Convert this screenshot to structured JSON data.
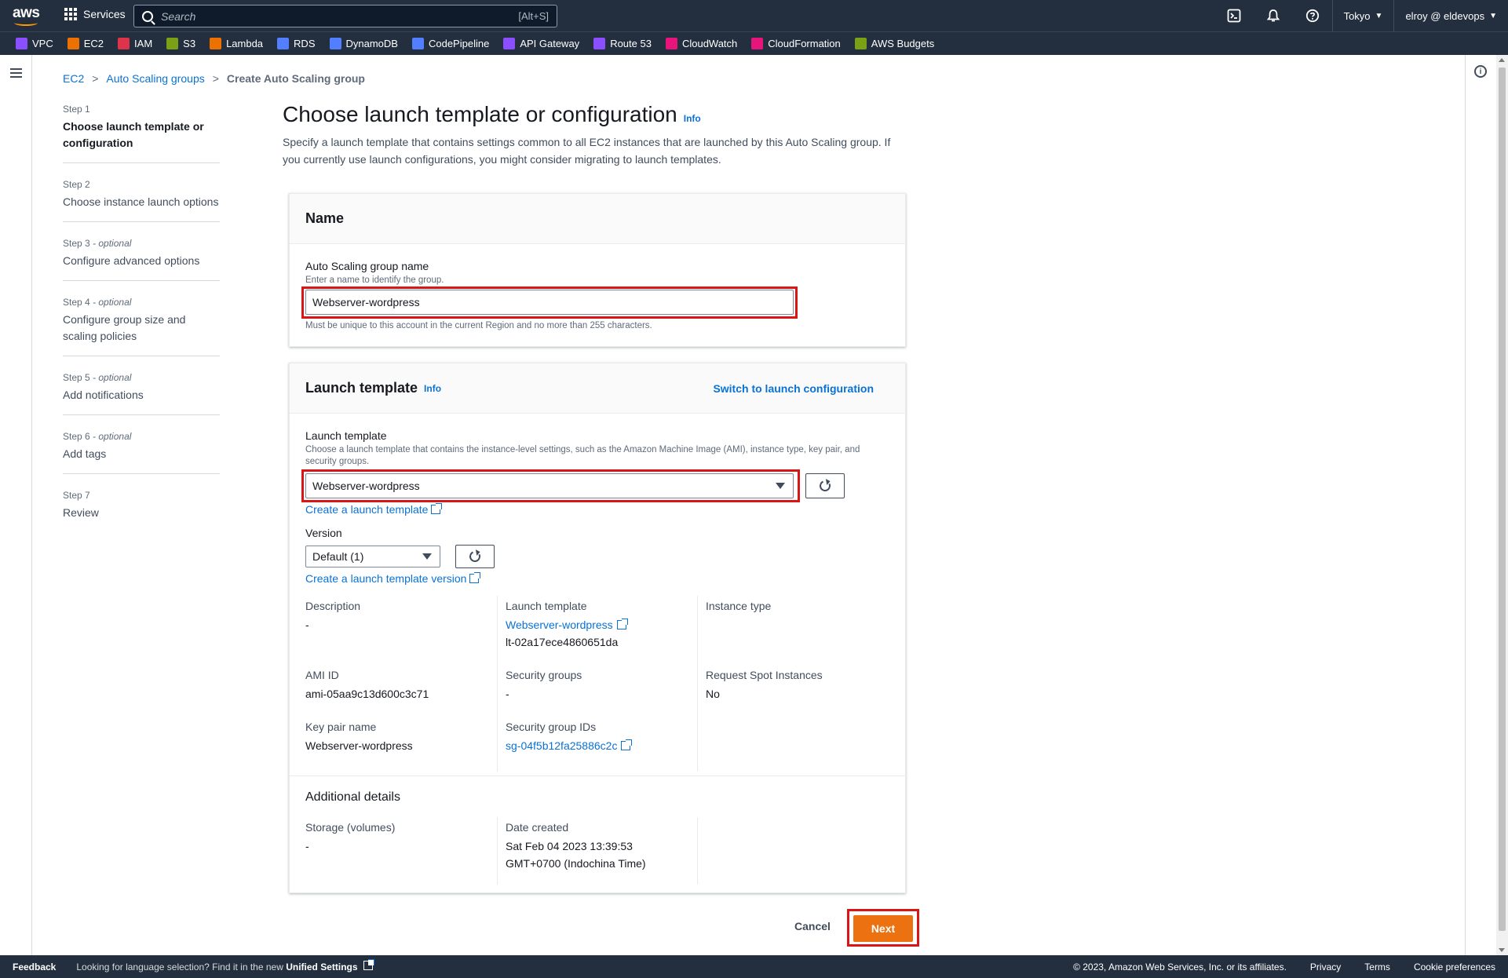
{
  "nav": {
    "logo": "aws",
    "services": "Services",
    "search_placeholder": "Search",
    "search_shortcut": "[Alt+S]",
    "region": "Tokyo",
    "user": "elroy @ eldevops"
  },
  "favorites": [
    {
      "label": "VPC",
      "color": "#8c4fff"
    },
    {
      "label": "EC2",
      "color": "#ed7100"
    },
    {
      "label": "IAM",
      "color": "#dd344c"
    },
    {
      "label": "S3",
      "color": "#7aa116"
    },
    {
      "label": "Lambda",
      "color": "#ed7100"
    },
    {
      "label": "RDS",
      "color": "#527fff"
    },
    {
      "label": "DynamoDB",
      "color": "#527fff"
    },
    {
      "label": "CodePipeline",
      "color": "#527fff"
    },
    {
      "label": "API Gateway",
      "color": "#8c4fff"
    },
    {
      "label": "Route 53",
      "color": "#8c4fff"
    },
    {
      "label": "CloudWatch",
      "color": "#e7157b"
    },
    {
      "label": "CloudFormation",
      "color": "#e7157b"
    },
    {
      "label": "AWS Budgets",
      "color": "#7aa116"
    }
  ],
  "breadcrumb": {
    "ec2": "EC2",
    "asg": "Auto Scaling groups",
    "current": "Create Auto Scaling group"
  },
  "steps": [
    {
      "num": "Step 1",
      "optional": "",
      "label": "Choose launch template or configuration"
    },
    {
      "num": "Step 2",
      "optional": "",
      "label": "Choose instance launch options"
    },
    {
      "num": "Step 3",
      "optional": " - optional",
      "label": "Configure advanced options"
    },
    {
      "num": "Step 4",
      "optional": " - optional",
      "label": "Configure group size and scaling policies"
    },
    {
      "num": "Step 5",
      "optional": " - optional",
      "label": "Add notifications"
    },
    {
      "num": "Step 6",
      "optional": " - optional",
      "label": "Add tags"
    },
    {
      "num": "Step 7",
      "optional": "",
      "label": "Review"
    }
  ],
  "page": {
    "title": "Choose launch template or configuration",
    "info": "Info",
    "desc": "Specify a launch template that contains settings common to all EC2 instances that are launched by this Auto Scaling group. If you currently use launch configurations, you might consider migrating to launch templates."
  },
  "name_panel": {
    "header": "Name",
    "label": "Auto Scaling group name",
    "hint": "Enter a name to identify the group.",
    "value": "Webserver-wordpress",
    "constraint": "Must be unique to this account in the current Region and no more than 255 characters."
  },
  "lt_panel": {
    "header": "Launch template",
    "info": "Info",
    "switch_link": "Switch to launch configuration",
    "label": "Launch template",
    "hint": "Choose a launch template that contains the instance-level settings, such as the Amazon Machine Image (AMI), instance type, key pair, and security groups.",
    "selected": "Webserver-wordpress",
    "create_link": "Create a launch template",
    "version_label": "Version",
    "version_selected": "Default (1)",
    "create_version_link": "Create a launch template version",
    "details": {
      "description_k": "Description",
      "description_v": "-",
      "lt_k": "Launch template",
      "lt_name": "Webserver-wordpress",
      "lt_id": "lt-02a17ece4860651da",
      "instance_type_k": "Instance type",
      "ami_k": "AMI ID",
      "ami_v": "ami-05aa9c13d600c3c71",
      "sg_k": "Security groups",
      "sg_v": "-",
      "spot_k": "Request Spot Instances",
      "spot_v": "No",
      "keypair_k": "Key pair name",
      "keypair_v": "Webserver-wordpress",
      "sgid_k": "Security group IDs",
      "sgid_v": "sg-04f5b12fa25886c2c"
    },
    "additional": {
      "header": "Additional details",
      "storage_k": "Storage (volumes)",
      "storage_v": "-",
      "date_k": "Date created",
      "date_v1": "Sat Feb 04 2023 13:39:53",
      "date_v2": "GMT+0700 (Indochina Time)"
    }
  },
  "actions": {
    "cancel": "Cancel",
    "next": "Next"
  },
  "footer": {
    "feedback": "Feedback",
    "lang_text": "Looking for language selection? Find it in the new ",
    "lang_link": "Unified Settings",
    "copyright": "© 2023, Amazon Web Services, Inc. or its affiliates.",
    "privacy": "Privacy",
    "terms": "Terms",
    "cookies": "Cookie preferences"
  }
}
